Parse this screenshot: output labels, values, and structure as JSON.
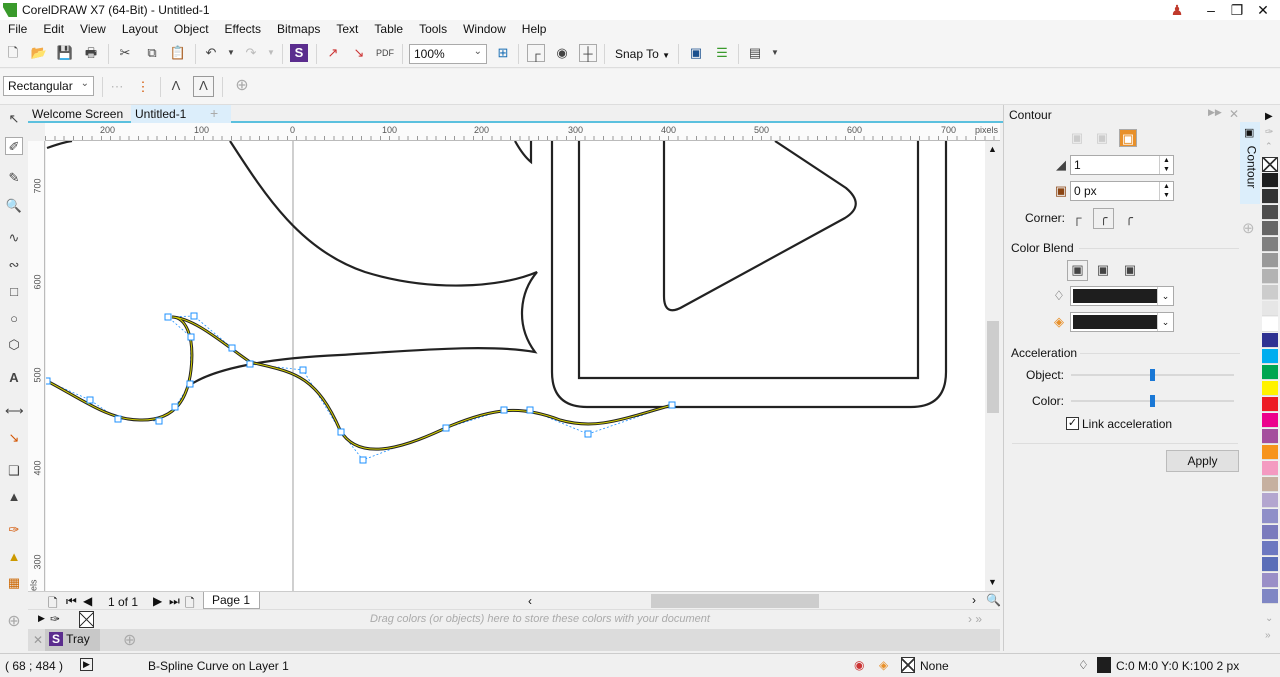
{
  "window": {
    "title": "CorelDRAW X7 (64-Bit) - Untitled-1",
    "controls": [
      "person-icon",
      "restore-icon",
      "close-icon"
    ]
  },
  "menu": [
    "File",
    "Edit",
    "View",
    "Layout",
    "Object",
    "Effects",
    "Bitmaps",
    "Text",
    "Table",
    "Tools",
    "Window",
    "Help"
  ],
  "toolbar": {
    "zoom": "100%",
    "snap_to": "Snap To"
  },
  "propbar": {
    "contour_type": "Rectangular"
  },
  "tabs": [
    {
      "label": "Welcome Screen",
      "active": false
    },
    {
      "label": "Untitled-1",
      "active": true
    }
  ],
  "ruler": {
    "h_labels": [
      "200",
      "100",
      "0",
      "100",
      "200",
      "300",
      "400",
      "500",
      "600",
      "700"
    ],
    "h_unit": "pixels",
    "v_labels": [
      "700",
      "600",
      "500",
      "400",
      "300"
    ],
    "v_unit": "pixels"
  },
  "pagebar": {
    "page_count": "1 of 1",
    "page_tab": "Page 1"
  },
  "colortray": {
    "hint": "Drag colors (or objects) here to store these colors with your document"
  },
  "tray": {
    "label": "Tray"
  },
  "status": {
    "coords": "( 68   ; 484   )",
    "object_info": "B-Spline Curve on Layer 1",
    "fill": "None",
    "outline": "C:0 M:0 Y:0 K:100  2 px"
  },
  "docker": {
    "title": "Contour",
    "side_tab": "Contour",
    "steps": "1",
    "offset": "0 px",
    "corner_label": "Corner:",
    "color_blend_label": "Color Blend",
    "outline_color": "#1e1e1e",
    "fill_color": "#1e1e1e",
    "acceleration_label": "Acceleration",
    "object_label": "Object:",
    "object_acceleration": 0.5,
    "color_label": "Color:",
    "color_acceleration": 0.5,
    "link_acceleration_label": "Link acceleration",
    "link_acceleration": true,
    "apply": "Apply"
  },
  "palette": [
    "#1e1e1e",
    "#333333",
    "#4d4d4d",
    "#666666",
    "#808080",
    "#999999",
    "#b3b3b3",
    "#cccccc",
    "#e6e6e6",
    "#ffffff",
    "#2e3192",
    "#00aeef",
    "#00a651",
    "#fff200",
    "#ed1c24",
    "#ec008c",
    "#a54f9e",
    "#f7941d",
    "#f49ac1",
    "#c6b0a0",
    "#b3a6cf",
    "#8f8fc8",
    "#7b7bbd",
    "#6c78c0",
    "#5a6eb8",
    "#9a8fc7",
    "#7f86c4"
  ]
}
